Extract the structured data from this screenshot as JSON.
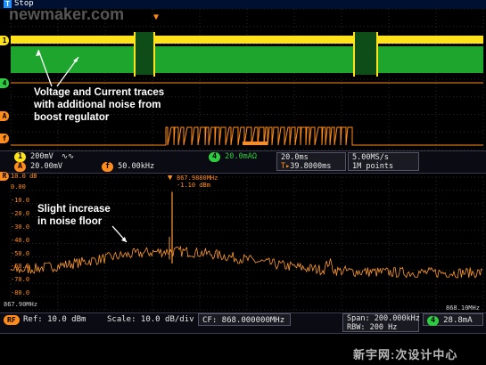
{
  "top": {
    "trigger_icon": "trigger-T-icon",
    "run_state": "Stop"
  },
  "watermark_top": "newmaker.com",
  "annotations": {
    "traces": [
      "Voltage and Current traces",
      "with additional noise from",
      "boost regulator"
    ],
    "noise": [
      "Slight increase",
      "in noise floor"
    ]
  },
  "channel_markers": [
    "1",
    "4",
    "A",
    "f"
  ],
  "time_readout": {
    "ch1": "200mV",
    "ch1_coupling": "∿∿",
    "ch4_id": "4",
    "ch4": "20.0mAΩ",
    "ref_id": "A",
    "ref": "20.00mV",
    "math_id": "f",
    "math": "50.00kHz",
    "timebase": "20.0ms",
    "trigger_pos": "39.8000ms",
    "sample_rate": "5.00MS/s",
    "record": "1M points"
  },
  "spectrum": {
    "axis_top_label": "10.0 dB",
    "y_ticks": [
      "0.00",
      "-10.0",
      "-20.0",
      "-30.0",
      "-40.0",
      "-50.0",
      "-60.0",
      "-70.0",
      "-80.0"
    ],
    "x_left": "867.90MHz",
    "x_right": "868.10MHz",
    "marker_freq": "867.9880MHz",
    "marker_level": "-1.10 dBm",
    "marker_id": "R"
  },
  "freq_readout": {
    "rf_id": "RF",
    "ref": "Ref: 10.0 dBm",
    "scale": "Scale: 10.0 dB/div",
    "cf": "CF: 868.000000MHz",
    "span": "Span:",
    "span_val": "200.000kHz",
    "rbw": "RBW:",
    "rbw_val": "200 Hz",
    "ch4_id": "4",
    "ch4_val": "28.8mA"
  },
  "watermark_bottom": "新宇网:次设计中心",
  "colors": {
    "ch1": "#ffe21a",
    "ch4": "#2ecc40",
    "ref": "#ff8c1a",
    "grid": "#2a2a2a",
    "bg": "#000000"
  }
}
